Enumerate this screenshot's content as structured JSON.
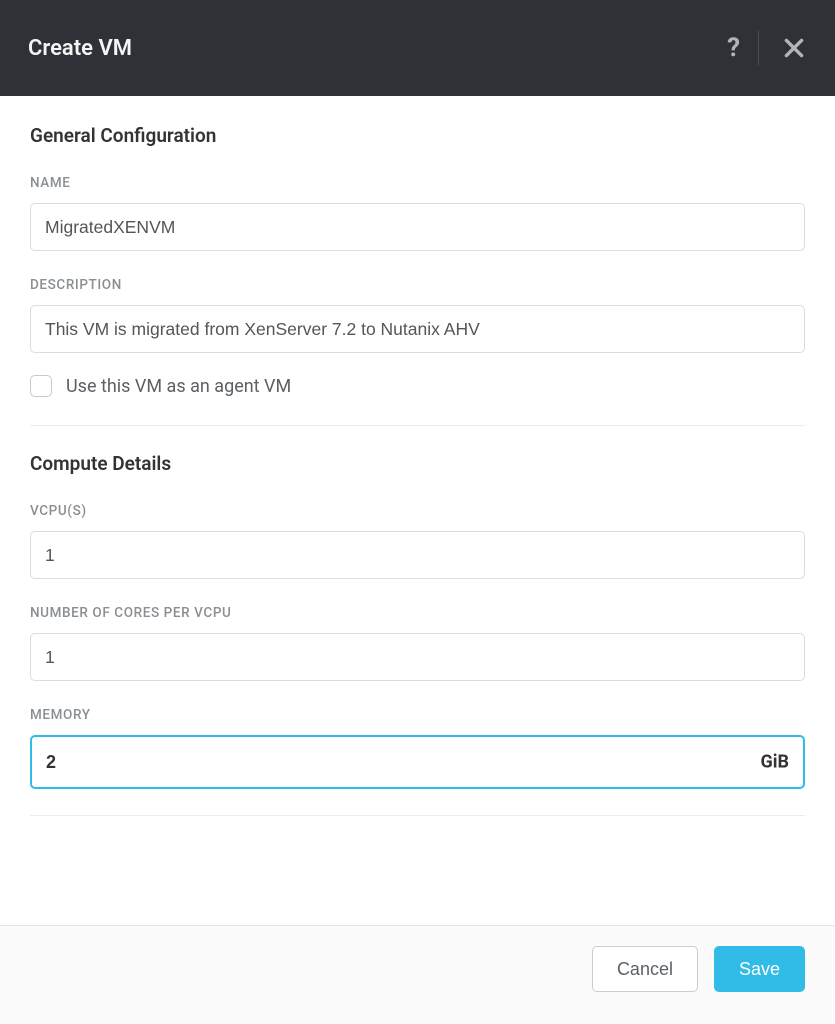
{
  "header": {
    "title": "Create VM"
  },
  "sections": {
    "general": {
      "title": "General Configuration",
      "name_label": "NAME",
      "name_value": "MigratedXENVM",
      "description_label": "DESCRIPTION",
      "description_value": "This VM is migrated from XenServer 7.2 to Nutanix AHV",
      "agent_checkbox_label": "Use this VM as an agent VM",
      "agent_checked": false
    },
    "compute": {
      "title": "Compute Details",
      "vcpus_label": "VCPU(S)",
      "vcpus_value": "1",
      "cores_label": "NUMBER OF CORES PER VCPU",
      "cores_value": "1",
      "memory_label": "MEMORY",
      "memory_value": "2",
      "memory_unit": "GiB"
    }
  },
  "footer": {
    "cancel_label": "Cancel",
    "save_label": "Save"
  }
}
